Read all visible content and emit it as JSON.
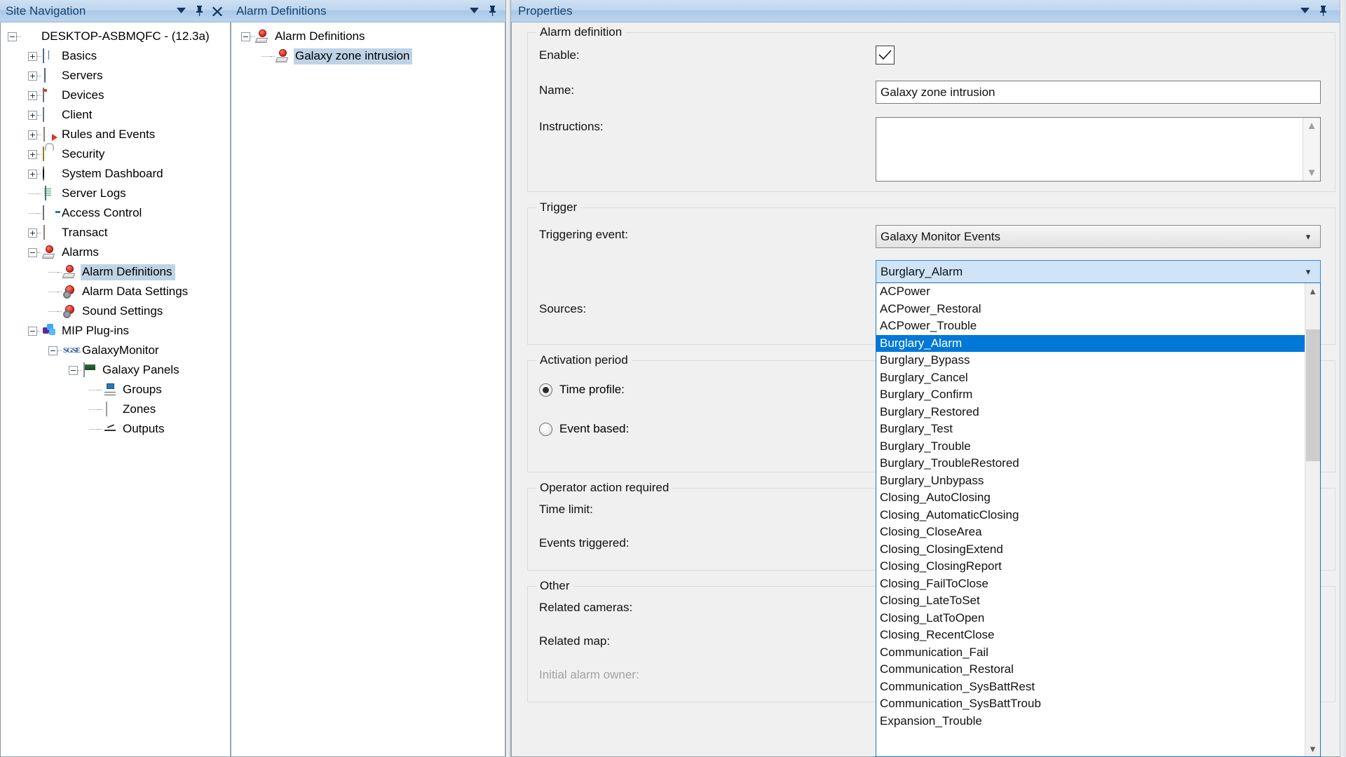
{
  "sitenav": {
    "title": "Site Navigation",
    "buttons": {
      "menu": "chevron-down-icon",
      "pin": "pin-icon",
      "close": "close-icon"
    },
    "tree": [
      {
        "label": "DESKTOP-ASBMQFC - (12.3a)",
        "depth": 0,
        "expander": "minus",
        "icon": "site-shield-icon"
      },
      {
        "label": "Basics",
        "depth": 1,
        "expander": "plus",
        "icon": "book-icon"
      },
      {
        "label": "Servers",
        "depth": 1,
        "expander": "plus",
        "icon": "server-icon"
      },
      {
        "label": "Devices",
        "depth": 1,
        "expander": "plus",
        "icon": "camera-icon"
      },
      {
        "label": "Client",
        "depth": 1,
        "expander": "plus",
        "icon": "monitor-icon"
      },
      {
        "label": "Rules and Events",
        "depth": 1,
        "expander": "plus",
        "icon": "rules-icon"
      },
      {
        "label": "Security",
        "depth": 1,
        "expander": "plus",
        "icon": "padlock-icon"
      },
      {
        "label": "System Dashboard",
        "depth": 1,
        "expander": "plus",
        "icon": "gauge-icon"
      },
      {
        "label": "Server Logs",
        "depth": 1,
        "expander": "none",
        "icon": "logs-icon"
      },
      {
        "label": "Access Control",
        "depth": 1,
        "expander": "none",
        "icon": "door-icon"
      },
      {
        "label": "Transact",
        "depth": 1,
        "expander": "plus",
        "icon": "transact-icon"
      },
      {
        "label": "Alarms",
        "depth": 1,
        "expander": "minus",
        "icon": "alarm-bell-icon"
      },
      {
        "label": "Alarm Definitions",
        "depth": 2,
        "expander": "none",
        "icon": "alarm-bell-icon",
        "selected": true
      },
      {
        "label": "Alarm Data Settings",
        "depth": 2,
        "expander": "none",
        "icon": "alarm-cog-icon"
      },
      {
        "label": "Sound Settings",
        "depth": 2,
        "expander": "none",
        "icon": "alarm-cog-icon"
      },
      {
        "label": "MIP Plug-ins",
        "depth": 1,
        "expander": "minus",
        "icon": "puzzle-icon"
      },
      {
        "label": "GalaxyMonitor",
        "depth": 2,
        "expander": "minus",
        "icon": "sgse-icon"
      },
      {
        "label": "Galaxy Panels",
        "depth": 3,
        "expander": "minus",
        "icon": "panel-icon"
      },
      {
        "label": "Groups",
        "depth": 4,
        "expander": "none",
        "icon": "groups-icon"
      },
      {
        "label": "Zones",
        "depth": 4,
        "expander": "none",
        "icon": "zone-icon"
      },
      {
        "label": "Outputs",
        "depth": 4,
        "expander": "none",
        "icon": "output-icon"
      }
    ]
  },
  "alarmdefs": {
    "title": "Alarm Definitions",
    "buttons": {
      "menu": "chevron-down-icon",
      "pin": "pin-icon"
    },
    "tree": [
      {
        "label": "Alarm Definitions",
        "depth": 0,
        "expander": "minus",
        "icon": "alarm-bell-icon"
      },
      {
        "label": "Galaxy zone intrusion",
        "depth": 1,
        "expander": "none",
        "icon": "alarm-bell-icon",
        "selected": true
      }
    ]
  },
  "properties": {
    "title": "Properties",
    "buttons": {
      "menu": "chevron-down-icon",
      "pin": "pin-icon"
    },
    "groups": {
      "alarm_definition": {
        "legend": "Alarm definition",
        "enable_label": "Enable:",
        "enable_checked": true,
        "name_label": "Name:",
        "name_value": "Galaxy zone intrusion",
        "instructions_label": "Instructions:",
        "instructions_value": ""
      },
      "trigger": {
        "legend": "Trigger",
        "triggering_event_label": "Triggering event:",
        "triggering_event_value": "Galaxy Monitor Events",
        "event_type_value": "Burglary_Alarm",
        "sources_label": "Sources:"
      },
      "activation_period": {
        "legend": "Activation period",
        "time_profile_label": "Time profile:",
        "event_based_label": "Event based:",
        "selected": "time_profile"
      },
      "operator_action": {
        "legend": "Operator action required",
        "time_limit_label": "Time limit:",
        "events_triggered_label": "Events triggered:"
      },
      "other": {
        "legend": "Other",
        "related_cameras_label": "Related cameras:",
        "related_map_label": "Related map:",
        "initial_alarm_owner_label": "Initial alarm owner:"
      }
    }
  },
  "dropdown": {
    "selected": "Burglary_Alarm",
    "items": [
      "ACPower",
      "ACPower_Restoral",
      "ACPower_Trouble",
      "Burglary_Alarm",
      "Burglary_Bypass",
      "Burglary_Cancel",
      "Burglary_Confirm",
      "Burglary_Restored",
      "Burglary_Test",
      "Burglary_Trouble",
      "Burglary_TroubleRestored",
      "Burglary_Unbypass",
      "Closing_AutoClosing",
      "Closing_AutomaticClosing",
      "Closing_CloseArea",
      "Closing_ClosingExtend",
      "Closing_ClosingReport",
      "Closing_FailToClose",
      "Closing_LateToSet",
      "Closing_LatToOpen",
      "Closing_RecentClose",
      "Communication_Fail",
      "Communication_Restoral",
      "Communication_SysBattRest",
      "Communication_SysBattTroub",
      "Expansion_Trouble"
    ]
  },
  "colors": {
    "title_bar": "#a8c8e8",
    "title_text": "#16436d",
    "selection": "#0078d7",
    "tree_selection": "#bfd3e6",
    "panel_bg": "#f0f0f0",
    "combo_open_border": "#2f8bd8"
  }
}
